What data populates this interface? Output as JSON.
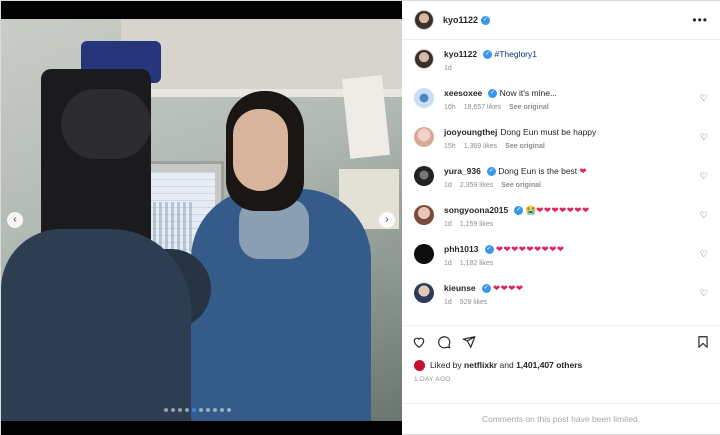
{
  "post": {
    "author": "kyo1122",
    "caption_author": "kyo1122",
    "caption_tag": "#Theglory1",
    "caption_age": "1d"
  },
  "comments": [
    {
      "user": "xeesoxee",
      "text": "Now it's mine...",
      "age": "16h",
      "likes": "18,657 likes",
      "see": "See original",
      "avatar": "avatar-blue-eye"
    },
    {
      "user": "jooyoungthej",
      "text": "Dong Eun must be happy",
      "age": "15h",
      "likes": "1,369 likes",
      "see": "See original",
      "avatar": "avatar-portrait"
    },
    {
      "user": "yura_936",
      "text": "Dong Eun is the best",
      "hearts": "❤",
      "age": "1d",
      "likes": "2,359 likes",
      "see": "See original",
      "avatar": "avatar-bw-portrait"
    },
    {
      "user": "songyoona2015",
      "text": "😭",
      "hearts": "❤❤❤❤❤❤❤",
      "age": "1d",
      "likes": "1,159 likes",
      "avatar": "avatar-portrait"
    },
    {
      "user": "phh1013",
      "text": "",
      "hearts": "❤❤❤❤❤❤❤❤❤",
      "age": "1d",
      "likes": "1,182 likes",
      "avatar": "avatar-black"
    },
    {
      "user": "kieunse",
      "text": "",
      "hearts": "❤❤❤❤",
      "age": "1d",
      "likes": "929 likes",
      "avatar": "avatar-portrait"
    }
  ],
  "likes": {
    "prefix": "Liked by",
    "user": "netflixkr",
    "joiner": "and",
    "count": "1,401,407 others"
  },
  "posted": "1 DAY AGO",
  "limited_notice": "Comments on this post have been limited.",
  "carousel": {
    "prev": "‹",
    "next": "›",
    "total": 10,
    "current": 4
  },
  "colors": {
    "verified": "#3897f0",
    "heart": "#e0245e",
    "active_dot": "#3b82f6"
  },
  "icons": [
    "more-options-icon",
    "verified-icon",
    "comment-like-heart-icon",
    "like-icon",
    "comment-icon",
    "share-icon",
    "save-icon",
    "carousel-prev-icon",
    "carousel-next-icon"
  ]
}
